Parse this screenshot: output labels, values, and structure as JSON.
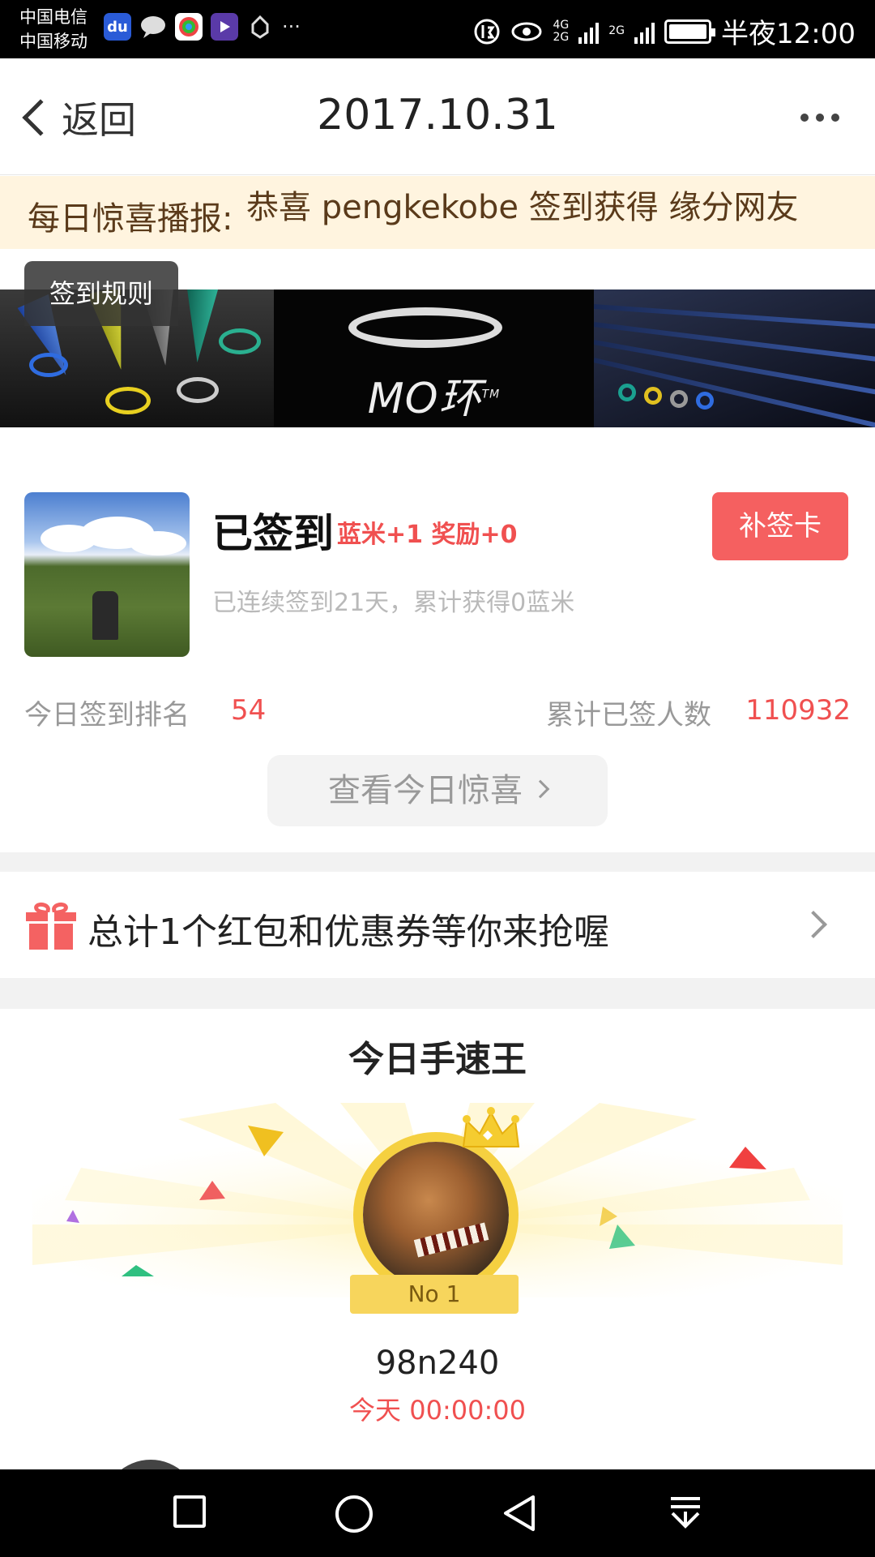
{
  "status_bar": {
    "carrier_1": "中国电信",
    "carrier_2": "中国移动",
    "app_icons": [
      "baidu-icon",
      "message-icon",
      "browser-icon",
      "video-icon",
      "hand-icon"
    ],
    "more_indicator": "···",
    "network_top": "4G",
    "network_bottom": "2G",
    "network_2": "2G",
    "time": "半夜12:00"
  },
  "header": {
    "back_label": "返回",
    "title": "2017.10.31"
  },
  "marquee": {
    "label": "每日惊喜播报:",
    "text": "恭喜 pengkekobe 签到获得 缘分网友"
  },
  "banner": {
    "rules_button": "签到规则",
    "logo_text": "MO环",
    "logo_tm": "TM"
  },
  "sign": {
    "status": "已签到",
    "reward": "蓝米+1 奖励+0",
    "makeup_button": "补签卡",
    "streak": "已连续签到21天，累计获得0蓝米",
    "rank_label": "今日签到排名",
    "rank_value": "54",
    "total_label": "累计已签人数",
    "total_value": "110932",
    "surprise_button": "查看今日惊喜"
  },
  "coupon": {
    "text": "总计1个红包和优惠券等你来抢喔"
  },
  "speed_king": {
    "title": "今日手速王",
    "badge": "No 1",
    "name": "98n240",
    "time": "今天 00:00:00"
  },
  "colors": {
    "accent_red": "#f05050",
    "button_red": "#f56060",
    "marquee_bg": "#fff4df",
    "gold": "#f5d040"
  }
}
